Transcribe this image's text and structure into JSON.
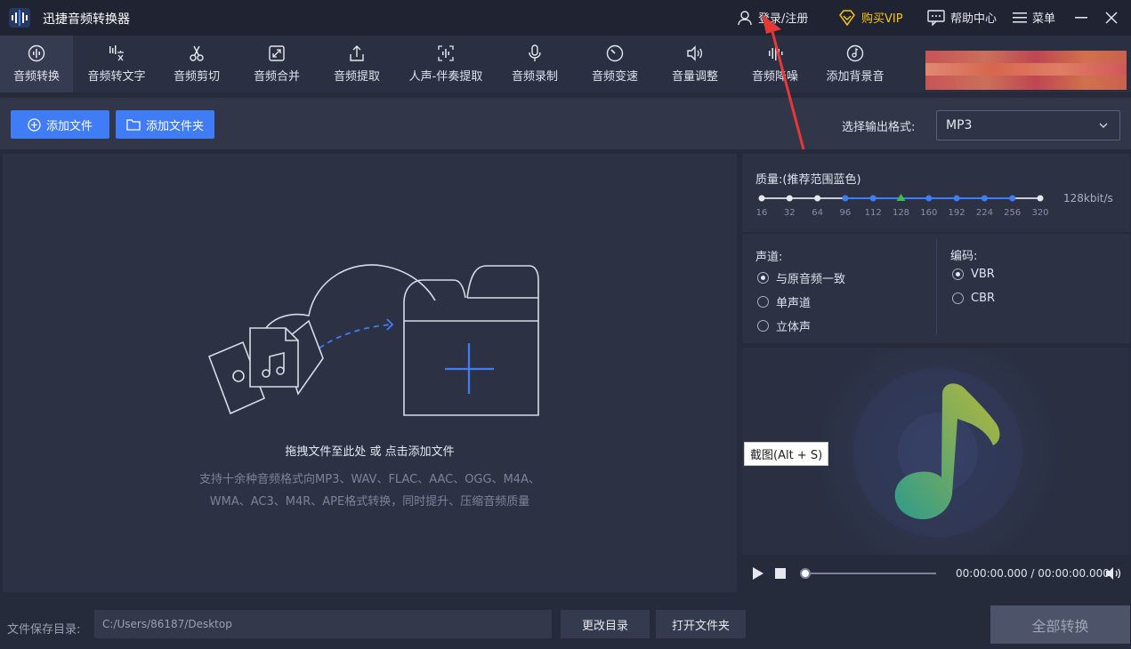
{
  "app": {
    "title": "迅捷音频转换器"
  },
  "titlebar": {
    "login": "登录/注册",
    "vip": "购买VIP",
    "help": "帮助中心",
    "menu": "菜单"
  },
  "nav": {
    "items": [
      {
        "label": "音频转换",
        "icon": "audio-convert-icon"
      },
      {
        "label": "音频转文字",
        "icon": "audio-to-text-icon"
      },
      {
        "label": "音频剪切",
        "icon": "scissors-icon"
      },
      {
        "label": "音频合并",
        "icon": "merge-icon"
      },
      {
        "label": "音频提取",
        "icon": "extract-icon"
      },
      {
        "label": "人声-伴奏提取",
        "icon": "vocal-separate-icon"
      },
      {
        "label": "音频录制",
        "icon": "microphone-icon"
      },
      {
        "label": "音频变速",
        "icon": "speed-icon"
      },
      {
        "label": "音量调整",
        "icon": "volume-adjust-icon"
      },
      {
        "label": "音频降噪",
        "icon": "denoise-icon"
      },
      {
        "label": "添加背景音",
        "icon": "background-music-icon"
      }
    ],
    "active": 0
  },
  "toolbar": {
    "add_file": "添加文件",
    "add_folder": "添加文件夹",
    "format_label": "选择输出格式:",
    "format_value": "MP3"
  },
  "drop": {
    "title": "拖拽文件至此处 或 点击添加文件",
    "desc": "支持十余种音频格式向MP3、WAV、FLAC、AAC、OGG、M4A、WMA、AC3、M4R、APE格式转换，同时提升、压缩音频质量"
  },
  "quality": {
    "label": "质量:(推荐范围蓝色)",
    "value": "128kbit/s",
    "ticks": [
      "16",
      "32",
      "64",
      "96",
      "112",
      "128",
      "160",
      "192",
      "224",
      "256",
      "320"
    ],
    "selected": "128",
    "recommended": [
      "96",
      "112",
      "128",
      "160",
      "192",
      "224",
      "256"
    ]
  },
  "channel": {
    "label": "声道:",
    "options": [
      "与原音频一致",
      "单声道",
      "立体声"
    ],
    "selected": "与原音频一致"
  },
  "encoding": {
    "label": "编码:",
    "options": [
      "VBR",
      "CBR"
    ],
    "selected": "VBR"
  },
  "tooltip": "截图(Alt + S)",
  "player": {
    "time": "00:00:00.000 / 00:00:00.000"
  },
  "bottom": {
    "save_label": "文件保存目录:",
    "path": "C:/Users/86187/Desktop",
    "change_dir": "更改目录",
    "open_folder": "打开文件夹",
    "convert_all": "全部转换"
  },
  "colors": {
    "accent": "#3f7cf6",
    "vip": "#f5c518",
    "annotation_arrow": "#e53935"
  }
}
